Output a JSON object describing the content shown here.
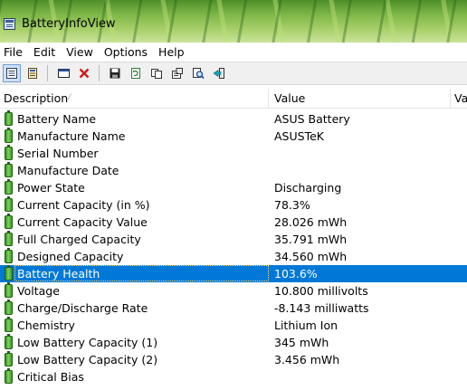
{
  "window": {
    "title": "BatteryInfoView"
  },
  "menu": [
    "File",
    "Edit",
    "View",
    "Options",
    "Help"
  ],
  "toolbar": {
    "buttons": [
      {
        "icon": "details-view-icon"
      },
      {
        "icon": "log-view-icon"
      },
      {
        "icon": "window-icon"
      },
      {
        "icon": "delete-icon"
      },
      {
        "icon": "save-icon"
      },
      {
        "icon": "refresh-icon"
      },
      {
        "icon": "copy-icon"
      },
      {
        "icon": "properties-icon"
      },
      {
        "icon": "find-icon"
      },
      {
        "icon": "exit-icon"
      }
    ]
  },
  "columns": {
    "description": "Description",
    "value": "Value",
    "extra": "Va"
  },
  "rows": [
    {
      "description": "Battery Name",
      "value": "ASUS Battery"
    },
    {
      "description": "Manufacture Name",
      "value": "ASUSTeK"
    },
    {
      "description": "Serial Number",
      "value": ""
    },
    {
      "description": "Manufacture Date",
      "value": ""
    },
    {
      "description": "Power State",
      "value": "Discharging"
    },
    {
      "description": "Current Capacity (in %)",
      "value": "78.3%"
    },
    {
      "description": "Current Capacity Value",
      "value": "28.026 mWh"
    },
    {
      "description": "Full Charged Capacity",
      "value": "35.791 mWh"
    },
    {
      "description": "Designed Capacity",
      "value": "34.560 mWh"
    },
    {
      "description": "Battery Health",
      "value": "103.6%",
      "selected": true
    },
    {
      "description": "Voltage",
      "value": "10.800 millivolts"
    },
    {
      "description": "Charge/Discharge Rate",
      "value": "-8.143 milliwatts"
    },
    {
      "description": "Chemistry",
      "value": "Lithium Ion"
    },
    {
      "description": "Low Battery Capacity (1)",
      "value": "345 mWh"
    },
    {
      "description": "Low Battery Capacity (2)",
      "value": "3.456 mWh"
    },
    {
      "description": "Critical Bias",
      "value": ""
    }
  ],
  "colors": {
    "selection": "#0078d7",
    "battery_icon": "#3c9a28"
  }
}
